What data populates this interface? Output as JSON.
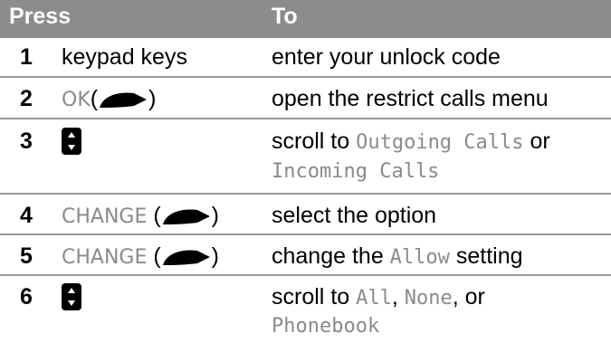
{
  "header": {
    "col1": "Press",
    "col2": "To"
  },
  "rows": [
    {
      "num": "1",
      "press": "keypad keys",
      "to": "enter your unlock code"
    },
    {
      "num": "2",
      "press_key": "OK",
      "press_open": "(",
      "press_close": ")",
      "to": "open the restrict calls menu"
    },
    {
      "num": "3",
      "press_icon": "nav-key-icon",
      "to_prefix": "scroll to ",
      "to_term1": "Outgoing Calls",
      "to_mid": " or",
      "to_term2": "Incoming Calls"
    },
    {
      "num": "4",
      "press_key": "CHANGE",
      "press_open": "(",
      "press_close": ")",
      "to": "select the option"
    },
    {
      "num": "5",
      "press_key": "CHANGE",
      "press_open": "(",
      "press_close": ")",
      "to_prefix": "change the ",
      "to_term1": "Allow",
      "to_suffix": " setting"
    },
    {
      "num": "6",
      "press_icon": "nav-key-icon",
      "to_prefix": "scroll to ",
      "to_term1": "All",
      "to_sep1": ", ",
      "to_term2": "None",
      "to_sep2": ", or",
      "to_term3": "Phonebook"
    }
  ],
  "colors": {
    "header_bg": "#8c8c8c",
    "rule": "#999999",
    "display_text": "#8a8a8a"
  }
}
